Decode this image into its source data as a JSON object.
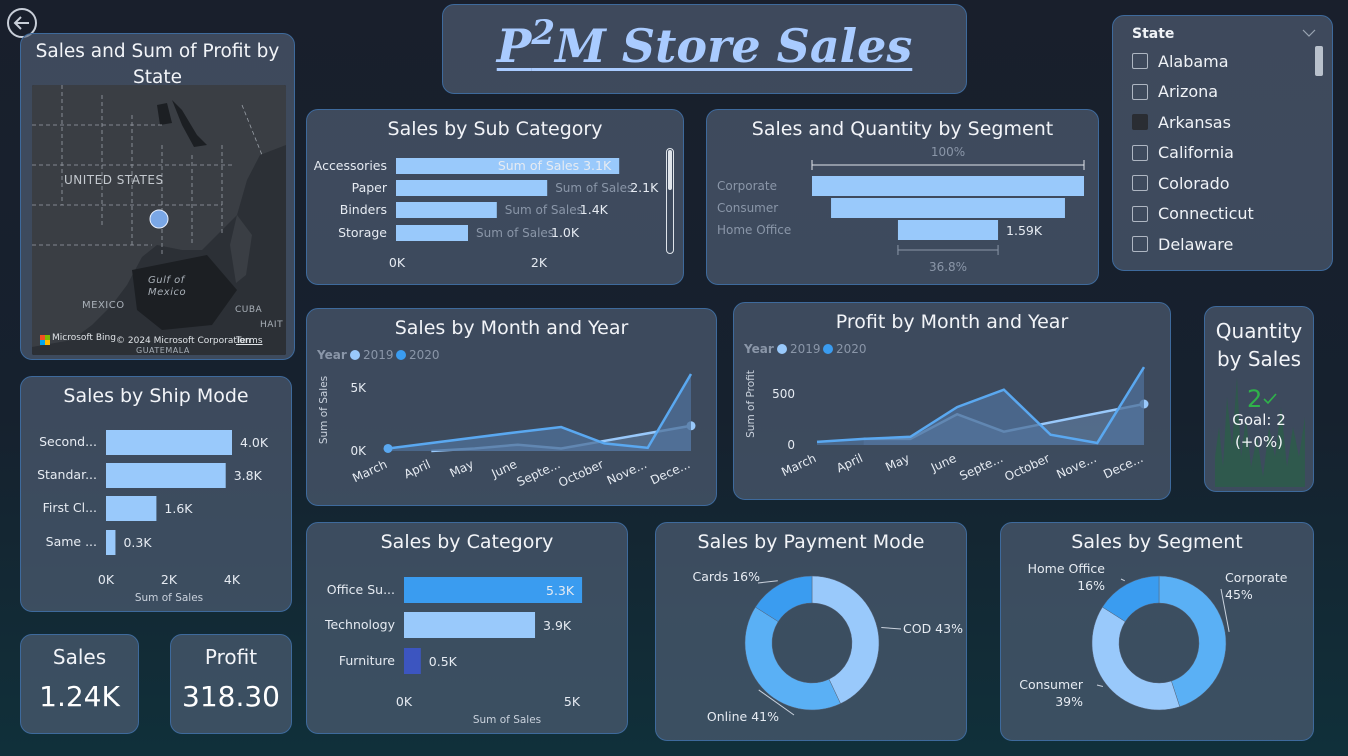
{
  "header": {
    "title_pre": "P",
    "title_sup": "2",
    "title_post": "M Store Sales"
  },
  "map": {
    "title": "Sales and Sum of Profit by State",
    "labels": {
      "us": "UNITED STATES",
      "gulf": "Gulf of Mexico",
      "mexico": "MEXICO",
      "cuba": "CUBA",
      "haiti": "HAIT",
      "guatemala": "GUATEMALA"
    },
    "credit_brand": "Microsoft Bing",
    "credit": "© 2024 Microsoft Corporation",
    "terms": "Terms"
  },
  "subcategory": {
    "title": "Sales by Sub Category",
    "series_label": "Sum of Sales",
    "ticks": [
      "0K",
      "2K"
    ]
  },
  "segment_funnel": {
    "title": "Sales and Quantity by Segment",
    "top_pct": "100%",
    "bottom_pct": "36.8%",
    "value_label": "1.59K"
  },
  "slicer": {
    "title": "State",
    "items": [
      {
        "label": "Alabama",
        "checked": false
      },
      {
        "label": "Arizona",
        "checked": false
      },
      {
        "label": "Arkansas",
        "checked": true
      },
      {
        "label": "California",
        "checked": false
      },
      {
        "label": "Colorado",
        "checked": false
      },
      {
        "label": "Connecticut",
        "checked": false
      },
      {
        "label": "Delaware",
        "checked": false
      }
    ]
  },
  "sales_month": {
    "title": "Sales by Month and Year",
    "legend_title": "Year",
    "legend": [
      "2019",
      "2020"
    ],
    "ylabel": "Sum of Sales",
    "yticks": [
      "5K",
      "0K"
    ],
    "months": [
      "March",
      "April",
      "May",
      "June",
      "Septe...",
      "October",
      "Nove...",
      "Dece..."
    ]
  },
  "profit_month": {
    "title": "Profit by Month and Year",
    "legend_title": "Year",
    "legend": [
      "2019",
      "2020"
    ],
    "ylabel": "Sum of Profit",
    "yticks": [
      "500",
      "0"
    ],
    "months": [
      "March",
      "April",
      "May",
      "June",
      "Septe...",
      "October",
      "Nove...",
      "Dece..."
    ]
  },
  "quantity_kpi": {
    "title": "Quantity by Sales",
    "value": "2",
    "goal": "Goal: 2",
    "delta": "(+0%)"
  },
  "ship_mode": {
    "title": "Sales by Ship Mode",
    "ticks": [
      "0K",
      "2K",
      "4K"
    ],
    "xlabel": "Sum of Sales"
  },
  "category": {
    "title": "Sales by Category",
    "ticks": [
      "0K",
      "5K"
    ],
    "xlabel": "Sum of Sales"
  },
  "payment": {
    "title": "Sales by Payment Mode"
  },
  "segment_donut": {
    "title": "Sales by Segment"
  },
  "kpi_sales": {
    "title": "Sales",
    "value": "1.24K"
  },
  "kpi_profit": {
    "title": "Profit",
    "value": "318.30"
  },
  "colors": {
    "bar": "#99c9fb",
    "bar_dark": "#5aa8f0",
    "accent": "#3a9cf0",
    "indigo": "#3c55c0",
    "green": "#2fb24a"
  },
  "chart_data": [
    {
      "type": "bar",
      "title": "Sales by Sub Category",
      "categories": [
        "Accessories",
        "Paper",
        "Binders",
        "Storage"
      ],
      "values": [
        3100,
        2100,
        1400,
        1000
      ],
      "data_labels": [
        "3.1K",
        "2.1K",
        "1.4K",
        "1.0K"
      ],
      "xlim": [
        0,
        3500
      ]
    },
    {
      "type": "bar",
      "title": "Sales and Quantity by Segment",
      "categories": [
        "Corporate",
        "Consumer",
        "Home Office"
      ],
      "values_pct": [
        100,
        86,
        36.8
      ],
      "data_labels": [
        "",
        "",
        "1.59K"
      ]
    },
    {
      "type": "bar",
      "title": "Sales by Ship Mode",
      "categories": [
        "Second...",
        "Standar...",
        "First Cl...",
        "Same ..."
      ],
      "values": [
        4000,
        3800,
        1600,
        300
      ],
      "data_labels": [
        "4.0K",
        "3.8K",
        "1.6K",
        "0.3K"
      ],
      "xlim": [
        0,
        4000
      ]
    },
    {
      "type": "bar",
      "title": "Sales by Category",
      "categories": [
        "Office Su...",
        "Technology",
        "Furniture"
      ],
      "values": [
        5300,
        3900,
        500
      ],
      "data_labels": [
        "5.3K",
        "3.9K",
        "0.5K"
      ],
      "xlim": [
        0,
        5000
      ]
    },
    {
      "type": "pie",
      "title": "Sales by Payment Mode",
      "labels": [
        "COD 43%",
        "Online 41%",
        "Cards 16%"
      ],
      "values": [
        43,
        41,
        16
      ]
    },
    {
      "type": "pie",
      "title": "Sales by Segment",
      "labels": [
        "Corporate 45%",
        "Consumer 39%",
        "Home Office 16%"
      ],
      "values": [
        45,
        39,
        16
      ]
    },
    {
      "type": "area",
      "title": "Sales by Month and Year",
      "categories": [
        "March",
        "April",
        "May",
        "June",
        "Septe...",
        "October",
        "Nove...",
        "Dece..."
      ],
      "series": [
        {
          "name": "2019",
          "values": [
            null,
            0,
            200,
            500,
            200,
            null,
            null,
            2000
          ]
        },
        {
          "name": "2020",
          "values": [
            200,
            null,
            null,
            1500,
            1900,
            600,
            250,
            6100
          ]
        }
      ],
      "ylim": [
        0,
        6500
      ]
    },
    {
      "type": "area",
      "title": "Profit by Month and Year",
      "categories": [
        "March",
        "April",
        "May",
        "June",
        "Septe...",
        "October",
        "Nove...",
        "Dece..."
      ],
      "series": [
        {
          "name": "2019",
          "values": [
            null,
            60,
            60,
            300,
            130,
            null,
            null,
            400
          ]
        },
        {
          "name": "2020",
          "values": [
            30,
            60,
            80,
            370,
            540,
            100,
            20,
            760
          ]
        }
      ],
      "ylim": [
        0,
        800
      ]
    }
  ]
}
